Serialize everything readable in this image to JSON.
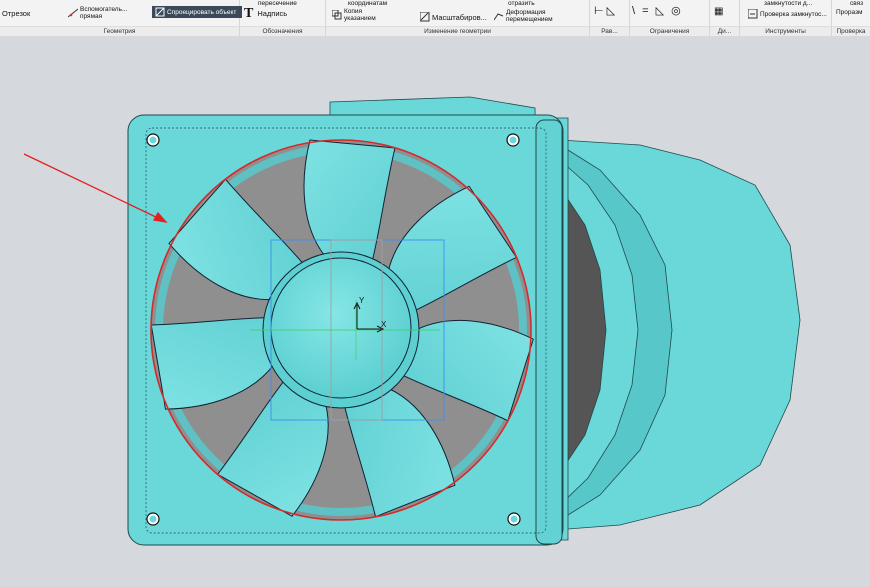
{
  "ribbon": {
    "geometry": {
      "segment_label": "Отрезок",
      "aux_line_label": "Вспомогатель... прямая",
      "project_label": "Спроецировать объект",
      "group_label": "Геометрия"
    },
    "annotations": {
      "intersection_label": "пересечение",
      "text_label": "Надпись",
      "group_label": "Обозначения"
    },
    "geometry_edit": {
      "by_coords_label": "координатам",
      "copy_label": "Копия указанием",
      "scale_label": "Масштабиров...",
      "mirror_label": "отразить",
      "deform_label": "Деформация перемещением",
      "group_label": "Изменение геометрии"
    },
    "constraints": {
      "group_label": "Ограничения",
      "rav_label": "Рав..."
    },
    "tools": {
      "closed_label": "замкнутости д...",
      "check_label": "Проверка замкнутос...",
      "di_label": "Ди...",
      "group_label": "Инструменты"
    },
    "check": {
      "group_label": "Проверка",
      "link_label": "связ",
      "pro_label": "Про",
      "size_label": "разм"
    }
  },
  "viewport": {
    "background": "#d5d8dc",
    "model_color": "#6ad7d9",
    "model_shadow": "#4fbcc0",
    "cavity_color": "#8f8f8f",
    "highlight_color": "#d62b2b",
    "arrow_color": "#e32020",
    "axis_labels": {
      "x": "X",
      "y": "Y"
    }
  }
}
